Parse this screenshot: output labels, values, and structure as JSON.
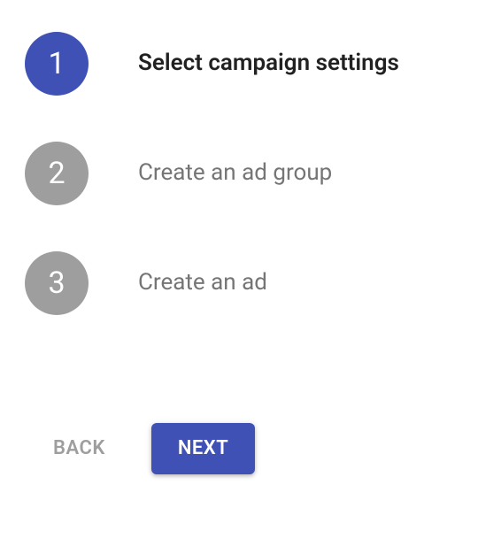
{
  "stepper": {
    "steps": [
      {
        "number": "1",
        "label": "Select campaign settings",
        "active": true
      },
      {
        "number": "2",
        "label": "Create an ad group",
        "active": false
      },
      {
        "number": "3",
        "label": "Create an ad",
        "active": false
      }
    ]
  },
  "actions": {
    "back_label": "Back",
    "next_label": "Next"
  }
}
